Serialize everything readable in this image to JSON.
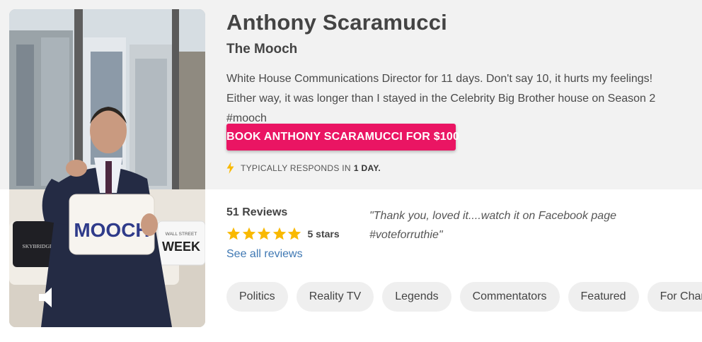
{
  "profile": {
    "name": "Anthony Scaramucci",
    "nickname": "The Mooch",
    "bio": "White House Communications Director for 11 days. Don't say 10, it hurts my feelings! Either way, it was longer than I stayed in the Celebrity Big Brother house on Season 2 #mooch"
  },
  "booking": {
    "button_label": "BOOK ANTHONY SCARAMUCCI FOR $100",
    "responds_prefix": "TYPICALLY RESPONDS IN",
    "responds_time": "1 DAY.",
    "accent_color": "#ea1563"
  },
  "video": {
    "pillow_text": "MOOCH",
    "pillow2_line1": "WALL STREET",
    "pillow2_line2": "WEEK",
    "pillow3_text": "SKYBRIDGE",
    "sound_icon": "speaker-icon"
  },
  "reviews": {
    "count_label": "51 Reviews",
    "rating": 5,
    "rating_label": "5 stars",
    "see_all_label": "See all reviews",
    "quote": "\"Thank you, loved it....watch it on Facebook page #voteforruthie\"",
    "star_color": "#f9b900",
    "link_color": "#3f78b3"
  },
  "tags": [
    "Politics",
    "Reality TV",
    "Legends",
    "Commentators",
    "Featured",
    "For Charity"
  ]
}
